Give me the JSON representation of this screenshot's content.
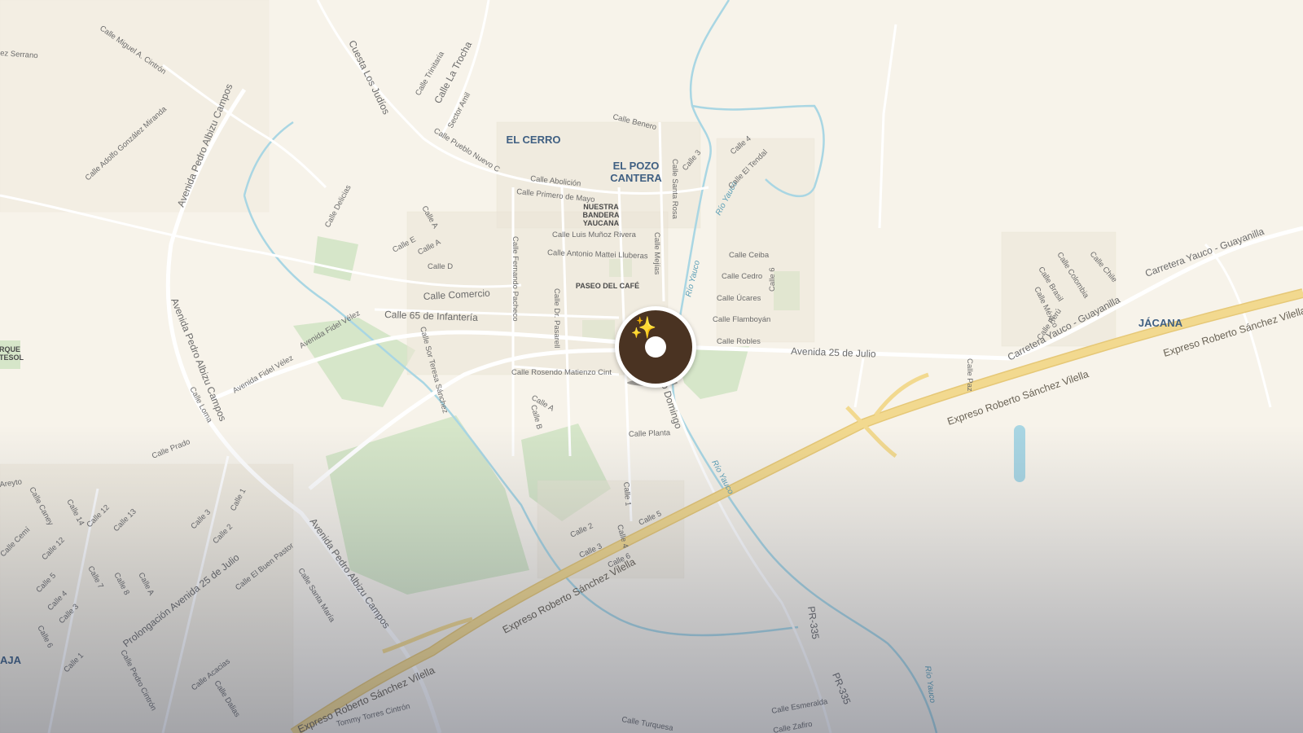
{
  "map": {
    "places": {
      "el_cerro": "EL CERRO",
      "el_pozo_cantera_1": "EL POZO",
      "el_pozo_cantera_2": "CANTERA",
      "jacana": "JÁCANA",
      "aja": "AJA",
      "parque_1": "RQUE",
      "parque_2": "TESOL"
    },
    "pois": {
      "nuestra_bandera_1": "NUESTRA",
      "nuestra_bandera_2": "BANDERA",
      "nuestra_bandera_3": "YAUCANA",
      "paseo_del_cafe": "PASEO DEL CAFÉ"
    },
    "rivers": {
      "rio_yauco_1": "Río Yauco",
      "rio_yauco_2": "Río Yauco",
      "rio_yauco_3": "Río Yauco",
      "rio_yauco_4": "Río Yauco"
    },
    "highways": {
      "expreso_1": "Expreso Roberto Sánchez Vilella",
      "expreso_2": "Expreso Roberto Sánchez Vilella",
      "expreso_3": "Expreso Roberto Sánchez Vilella",
      "expreso_4": "Expreso Roberto Sánchez Vilella"
    },
    "streets": {
      "serrano": "ez Serrano",
      "miguel_cintron": "Calle Miguel A. Cintrón",
      "cuesta_judios": "Cuesta Los Judíos",
      "trinitaria": "Calle Trinitaria",
      "la_trocha": "Calle La Trocha",
      "sector_amil": "Sector Amil",
      "pueblo_nuevo": "Calle Pueblo Nuevo C",
      "benero": "Calle Benero",
      "abolicion": "Calle Abolición",
      "primero_mayo": "Calle Primero de Mayo",
      "luis_munoz": "Calle Luis Muñoz Rivera",
      "antonio_mattei": "Calle Antonio Mattei Lluberas",
      "calle_a1": "Calle A",
      "calle_a2": "Calle A",
      "calle_e": "Calle E",
      "calle_d": "Calle D",
      "delicias": "Calle Delicias",
      "comercio": "Calle Comercio",
      "infanteria": "Calle 65 de Infantería",
      "fidel_velez_1": "Avenida Fidel Vélez",
      "fidel_velez_2": "Avenida Fidel Vélez",
      "albizu_1": "Avenida Pedro Albizu Campos",
      "albizu_2": "Avenida Pedro Albizu Campos",
      "albizu_3": "Avenida Pedro Albizu Campos",
      "adolfo_gonzalez": "Calle Adolfo González Miranda",
      "fernando_pacheco": "Calle Fernando Pacheco",
      "dr_pasarell": "Calle Dr. Pasarell",
      "sor_teresa": "Calle Sor Teresa Sánchez",
      "mejias": "Calle Mejías",
      "santa_rosa": "Calle Santa Rosa",
      "calle_3": "Calle 3",
      "calle_4": "Calle 4",
      "el_tendal": "Calle El Tendal",
      "ceiba": "Calle Ceiba",
      "cedro": "Calle Cedro",
      "ucares": "Calle Úcares",
      "calle_6": "Calle 6",
      "flamboyan": "Calle Flamboyán",
      "robles": "Calle Robles",
      "av_25_julio": "Avenida 25 de Julio",
      "rosendo": "Calle Rosendo Matienzo Cint",
      "domingo": "o Domingo",
      "calle_a3": "Calle A",
      "calle_b": "Calle B",
      "planta": "Calle Planta",
      "loma": "Calle Loma",
      "prado": "Calle Prado",
      "carretera_yauco_1": "Carretera Yauco - Guayanilla",
      "carretera_yauco_2": "Carretera Yauco - Guayanilla",
      "brasil": "Calle Brasil",
      "colombia": "Calle Colombia",
      "chile": "Calle Chile",
      "mexico": "Calle México",
      "peru": "Calle Perú",
      "paz": "Calle Paz",
      "pr335_1": "PR-335",
      "pr335_2": "PR-335",
      "prolongacion": "Prolongación Avenida 25 de Julio",
      "el_buen_pastor": "Calle El Buen Pastor",
      "santa_maria": "Calle Santa María",
      "acacias": "Calle Acacias",
      "dalias": "Calle Dalias",
      "pedro_cintron": "Calle Pedro Cintrón",
      "torres_cintron": "Tommy Torres Cintrón",
      "turquesa": "Calle Turquesa",
      "esmeralda": "Calle Esmeralda",
      "zafiro": "Calle Zafiro",
      "calle_1a": "Calle 1",
      "calle_2a": "Calle 2",
      "calle_3a": "Calle 3",
      "calle_1b": "Calle 1",
      "calle_2b": "Calle 2",
      "calle_3b": "Calle 3",
      "calle_4b": "Calle 4",
      "calle_5b": "Calle 5",
      "calle_6b": "Calle 6",
      "calle_12a": "Calle 12",
      "calle_12b": "Calle 12",
      "calle_13": "Calle 13",
      "calle_14": "Calle 14",
      "calle_7": "Calle 7",
      "calle_8": "Calle 8",
      "calle_a4": "Calle A",
      "calle_4c": "Calle 4",
      "calle_5c": "Calle 5",
      "calle_3c": "Calle 3",
      "calle_6c": "Calle 6",
      "calle_1c": "Calle 1",
      "cemi": "Calle Cemí",
      "caney": "Calle Caney",
      "areyto": "Areyto"
    },
    "marker_icon": "sparkles-icon",
    "marker_glyph": "✨",
    "colors": {
      "land": "#f7f3ea",
      "road": "#ffffff",
      "highway": "#f2d58a",
      "water": "#a9d6e3",
      "park": "#cfe3c4",
      "marker": "#4a3322",
      "place_label": "#3f5f82"
    }
  }
}
